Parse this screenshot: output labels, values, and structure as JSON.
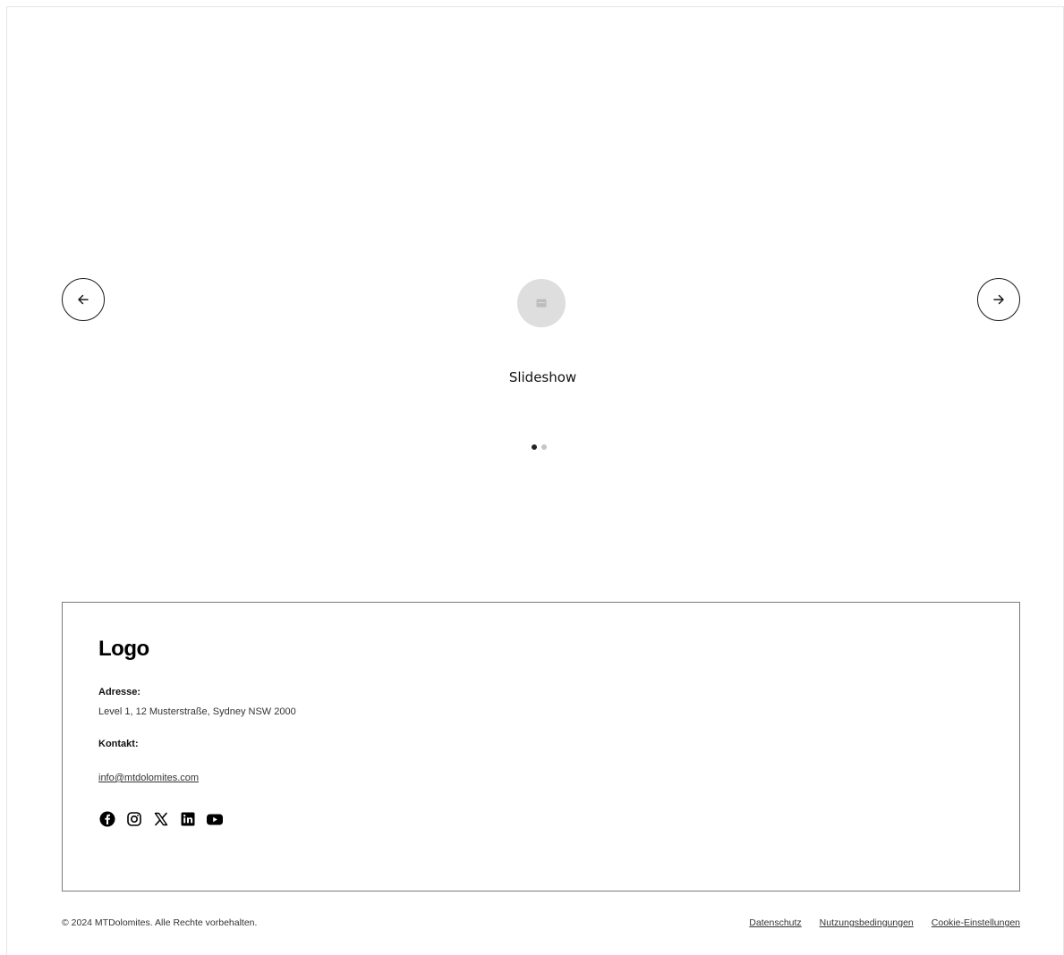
{
  "slideshow": {
    "caption": "Slideshow",
    "prev_icon": "arrow-left-icon",
    "next_icon": "arrow-right-icon",
    "placeholder_icon": "image-icon",
    "slide_count": 2,
    "active_slide": 1
  },
  "footer": {
    "logo": "Logo",
    "address_label": "Adresse:",
    "address_value": "Level 1, 12 Musterstraße, Sydney NSW 2000",
    "contact_label": "Kontakt:",
    "email": "info@mtdolomites.com",
    "socials": [
      "facebook-icon",
      "instagram-icon",
      "x-icon",
      "linkedin-icon",
      "youtube-icon"
    ]
  },
  "bottom": {
    "copyright": "© 2024 MTDolomites. Alle Rechte vorbehalten.",
    "links": [
      "Datenschutz",
      "Nutzungsbedingungen",
      "Cookie-Einstellungen"
    ]
  },
  "colors": {
    "text": "#000000",
    "border": "#7a7a7a",
    "placeholder": "#dedede",
    "dot_active": "#222222",
    "dot_inactive": "#c4c4c4"
  }
}
